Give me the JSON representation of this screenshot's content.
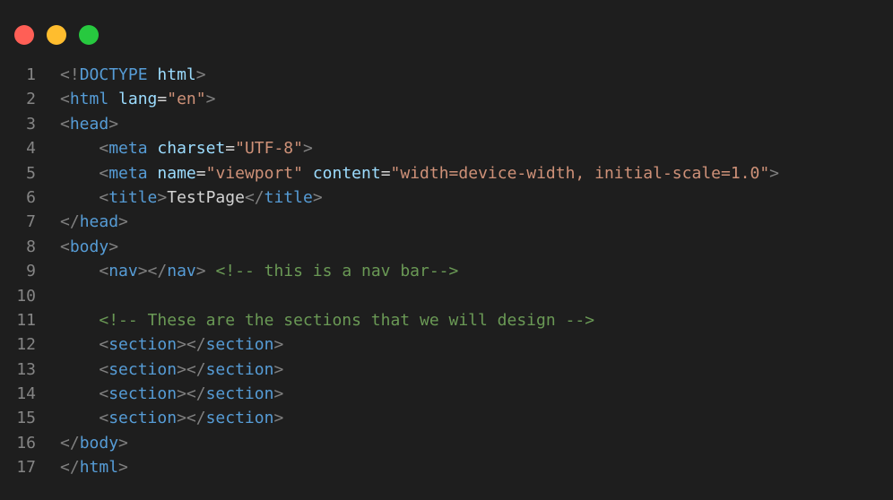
{
  "window": {
    "controls": {
      "close_color": "#ff5f56",
      "minimize_color": "#ffbd2e",
      "maximize_color": "#27c93f"
    }
  },
  "colors": {
    "background": "#1e1e1e",
    "line_number": "#858585",
    "punct": "#808080",
    "tag": "#569cd6",
    "attr": "#9cdcfe",
    "string": "#ce9178",
    "text": "#d4d4d4",
    "comment": "#6a9955"
  },
  "code": {
    "lines": [
      {
        "n": "1",
        "tokens": [
          [
            "punct",
            "<!"
          ],
          [
            "doctype",
            "DOCTYPE"
          ],
          [
            "text",
            " "
          ],
          [
            "attr",
            "html"
          ],
          [
            "punct",
            ">"
          ]
        ]
      },
      {
        "n": "2",
        "tokens": [
          [
            "punct",
            "<"
          ],
          [
            "tag",
            "html"
          ],
          [
            "text",
            " "
          ],
          [
            "attr",
            "lang"
          ],
          [
            "text",
            "="
          ],
          [
            "str",
            "\"en\""
          ],
          [
            "punct",
            ">"
          ]
        ]
      },
      {
        "n": "3",
        "tokens": [
          [
            "punct",
            "<"
          ],
          [
            "tag",
            "head"
          ],
          [
            "punct",
            ">"
          ]
        ]
      },
      {
        "n": "4",
        "tokens": [
          [
            "text",
            "    "
          ],
          [
            "punct",
            "<"
          ],
          [
            "tag",
            "meta"
          ],
          [
            "text",
            " "
          ],
          [
            "attr",
            "charset"
          ],
          [
            "text",
            "="
          ],
          [
            "str",
            "\"UTF-8\""
          ],
          [
            "punct",
            ">"
          ]
        ]
      },
      {
        "n": "5",
        "tokens": [
          [
            "text",
            "    "
          ],
          [
            "punct",
            "<"
          ],
          [
            "tag",
            "meta"
          ],
          [
            "text",
            " "
          ],
          [
            "attr",
            "name"
          ],
          [
            "text",
            "="
          ],
          [
            "str",
            "\"viewport\""
          ],
          [
            "text",
            " "
          ],
          [
            "attr",
            "content"
          ],
          [
            "text",
            "="
          ],
          [
            "str",
            "\"width=device-width, initial-scale=1.0\""
          ],
          [
            "punct",
            ">"
          ]
        ]
      },
      {
        "n": "6",
        "tokens": [
          [
            "text",
            "    "
          ],
          [
            "punct",
            "<"
          ],
          [
            "tag",
            "title"
          ],
          [
            "punct",
            ">"
          ],
          [
            "text",
            "TestPage"
          ],
          [
            "punct",
            "</"
          ],
          [
            "tag",
            "title"
          ],
          [
            "punct",
            ">"
          ]
        ]
      },
      {
        "n": "7",
        "tokens": [
          [
            "punct",
            "</"
          ],
          [
            "tag",
            "head"
          ],
          [
            "punct",
            ">"
          ]
        ]
      },
      {
        "n": "8",
        "tokens": [
          [
            "punct",
            "<"
          ],
          [
            "tag",
            "body"
          ],
          [
            "punct",
            ">"
          ]
        ]
      },
      {
        "n": "9",
        "tokens": [
          [
            "text",
            "    "
          ],
          [
            "punct",
            "<"
          ],
          [
            "tag",
            "nav"
          ],
          [
            "punct",
            "></"
          ],
          [
            "tag",
            "nav"
          ],
          [
            "punct",
            ">"
          ],
          [
            "text",
            " "
          ],
          [
            "comment",
            "<!-- this is a nav bar-->"
          ]
        ]
      },
      {
        "n": "10",
        "tokens": []
      },
      {
        "n": "11",
        "tokens": [
          [
            "text",
            "    "
          ],
          [
            "comment",
            "<!-- These are the sections that we will design -->"
          ]
        ]
      },
      {
        "n": "12",
        "tokens": [
          [
            "text",
            "    "
          ],
          [
            "punct",
            "<"
          ],
          [
            "tag",
            "section"
          ],
          [
            "punct",
            "></"
          ],
          [
            "tag",
            "section"
          ],
          [
            "punct",
            ">"
          ]
        ]
      },
      {
        "n": "13",
        "tokens": [
          [
            "text",
            "    "
          ],
          [
            "punct",
            "<"
          ],
          [
            "tag",
            "section"
          ],
          [
            "punct",
            "></"
          ],
          [
            "tag",
            "section"
          ],
          [
            "punct",
            ">"
          ]
        ]
      },
      {
        "n": "14",
        "tokens": [
          [
            "text",
            "    "
          ],
          [
            "punct",
            "<"
          ],
          [
            "tag",
            "section"
          ],
          [
            "punct",
            "></"
          ],
          [
            "tag",
            "section"
          ],
          [
            "punct",
            ">"
          ]
        ]
      },
      {
        "n": "15",
        "tokens": [
          [
            "text",
            "    "
          ],
          [
            "punct",
            "<"
          ],
          [
            "tag",
            "section"
          ],
          [
            "punct",
            "></"
          ],
          [
            "tag",
            "section"
          ],
          [
            "punct",
            ">"
          ]
        ]
      },
      {
        "n": "16",
        "tokens": [
          [
            "punct",
            "</"
          ],
          [
            "tag",
            "body"
          ],
          [
            "punct",
            ">"
          ]
        ]
      },
      {
        "n": "17",
        "tokens": [
          [
            "punct",
            "</"
          ],
          [
            "tag",
            "html"
          ],
          [
            "punct",
            ">"
          ]
        ]
      }
    ]
  }
}
